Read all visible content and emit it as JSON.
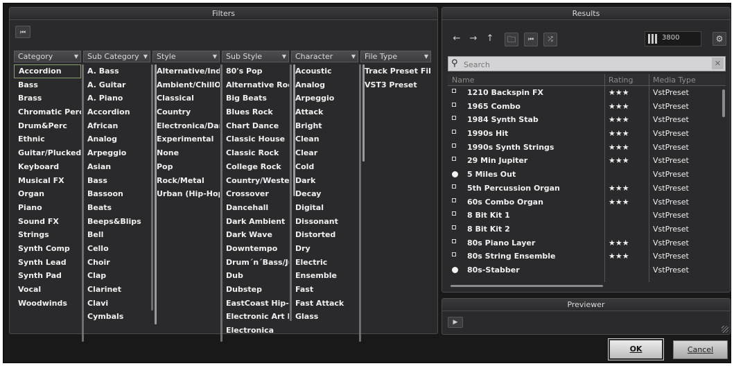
{
  "filters": {
    "title": "Filters",
    "reset_icon": "skip-back-icon",
    "columns": [
      {
        "header": "Category",
        "items": [
          "Accordion",
          "Bass",
          "Brass",
          "Chromatic Perc",
          "Drum&Perc",
          "Ethnic",
          "Guitar/Plucked",
          "Keyboard",
          "Musical FX",
          "Organ",
          "Piano",
          "Sound FX",
          "Strings",
          "Synth Comp",
          "Synth Lead",
          "Synth Pad",
          "Vocal",
          "Woodwinds"
        ]
      },
      {
        "header": "Sub Category",
        "items": [
          "A. Bass",
          "A. Guitar",
          "A. Piano",
          "Accordion",
          "African",
          "Analog",
          "Arpeggio",
          "Asian",
          "Bass",
          "Bassoon",
          "Beats",
          "Beeps&Blips",
          "Bell",
          "Cello",
          "Choir",
          "Clap",
          "Clarinet",
          "Clavi",
          "Cymbals"
        ]
      },
      {
        "header": "Style",
        "items": [
          "Alternative/Indie",
          "Ambient/ChillOut",
          "Classical",
          "Country",
          "Electronica/Dance",
          "Experimental",
          "None",
          "Pop",
          "Rock/Metal",
          "Urban (Hip-Hop / R&B)"
        ]
      },
      {
        "header": "Sub Style",
        "items": [
          "80's Pop",
          "Alternative Rock",
          "Big Beats",
          "Blues Rock",
          "Chart Dance",
          "Classic House",
          "Classic Rock",
          "College Rock",
          "Country/Western",
          "Crossover",
          "Dancehall",
          "Dark Ambient",
          "Dark Wave",
          "Downtempo",
          "Drum´n´Bass/Jungle",
          "Dub",
          "Dubstep",
          "EastCoast Hip-Hop",
          "Electronic Art Music",
          "Electronica"
        ]
      },
      {
        "header": "Character",
        "items": [
          "Acoustic",
          "Analog",
          "Arpeggio",
          "Attack",
          "Bright",
          "Clean",
          "Clear",
          "Cold",
          "Dark",
          "Decay",
          "Digital",
          "Dissonant",
          "Distorted",
          "Dry",
          "Electric",
          "Ensemble",
          "Fast",
          "Fast Attack",
          "Glass"
        ]
      },
      {
        "header": "File Type",
        "items": [
          "Track Preset File",
          "VST3 Preset"
        ]
      }
    ]
  },
  "results": {
    "title": "Results",
    "count": "3800",
    "search_placeholder": "Search",
    "headers": {
      "name": "Name",
      "rating": "Rating",
      "media_type": "Media Type"
    },
    "rows": [
      {
        "name": "1210 Backspin FX",
        "rating": "★★★",
        "type": "VstPreset",
        "icon": "preset-icon"
      },
      {
        "name": "1965 Combo",
        "rating": "★★★",
        "type": "VstPreset",
        "icon": "preset-icon"
      },
      {
        "name": "1984 Synth Stab",
        "rating": "★★★",
        "type": "VstPreset",
        "icon": "preset-icon"
      },
      {
        "name": "1990s Hit",
        "rating": "★★★",
        "type": "VstPreset",
        "icon": "preset-icon"
      },
      {
        "name": "1990s Synth Strings",
        "rating": "★★★",
        "type": "VstPreset",
        "icon": "preset-icon"
      },
      {
        "name": "29 Min Jupiter",
        "rating": "★★★",
        "type": "VstPreset",
        "icon": "preset-icon"
      },
      {
        "name": "5 Miles Out",
        "rating": "",
        "type": "VstPreset",
        "icon": "track-preset-icon"
      },
      {
        "name": "5th Percussion Organ",
        "rating": "★★★",
        "type": "VstPreset",
        "icon": "preset-icon"
      },
      {
        "name": "60s Combo Organ",
        "rating": "★★★",
        "type": "VstPreset",
        "icon": "preset-icon"
      },
      {
        "name": "8 Bit Kit 1",
        "rating": "",
        "type": "VstPreset",
        "icon": "preset-icon"
      },
      {
        "name": "8 Bit Kit 2",
        "rating": "",
        "type": "VstPreset",
        "icon": "preset-icon"
      },
      {
        "name": "80s Piano Layer",
        "rating": "★★★",
        "type": "VstPreset",
        "icon": "preset-icon"
      },
      {
        "name": "80s String Ensemble",
        "rating": "★★★",
        "type": "VstPreset",
        "icon": "preset-icon"
      },
      {
        "name": "80s-Stabber",
        "rating": "",
        "type": "VstPreset",
        "icon": "track-preset-icon"
      }
    ]
  },
  "previewer": {
    "title": "Previewer"
  },
  "dialog": {
    "ok_label": "OK",
    "cancel_label": "Cancel"
  },
  "colors": {
    "panel_bg": "#2a2a2c",
    "window_bg": "#19191a",
    "selection_border": "#8aa070"
  }
}
